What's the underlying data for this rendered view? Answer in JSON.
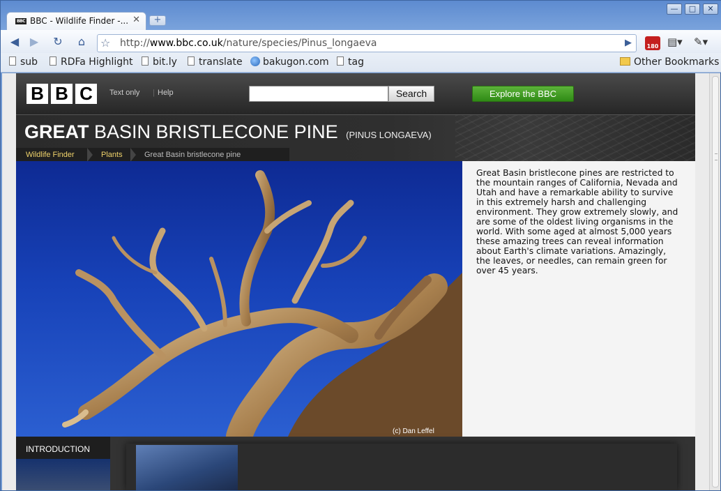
{
  "browser": {
    "tab_title": "BBC - Wildlife Finder -...",
    "tab_close": "✕",
    "new_tab": "+",
    "favicon_text": "BBC",
    "url_prefix": "http://",
    "url_domain": "www.bbc.co.uk",
    "url_path": "/nature/species/Pinus_longaeva",
    "extension_badge": "180",
    "window_controls": [
      "—",
      "□",
      "✕"
    ]
  },
  "bookmarks": [
    {
      "label": "sub",
      "icon": "page"
    },
    {
      "label": "RDFa Highlight",
      "icon": "page"
    },
    {
      "label": "bit.ly",
      "icon": "page"
    },
    {
      "label": "translate",
      "icon": "page"
    },
    {
      "label": "bakugon.com",
      "icon": "globe"
    },
    {
      "label": "tag",
      "icon": "page"
    }
  ],
  "other_bookmarks": "Other Bookmarks",
  "bbc": {
    "logo": [
      "B",
      "B",
      "C"
    ],
    "text_only": "Text only",
    "help": "Help",
    "search_button": "Search",
    "search_placeholder": "",
    "explore_button": "Explore the BBC"
  },
  "species": {
    "title_bold": "GREAT",
    "title_rest": " BASIN BRISTLECONE PINE",
    "latin_name": "(PINUS LONGAEVA)",
    "breadcrumbs": [
      "Wildlife Finder",
      "Plants",
      "Great Basin bristlecone pine"
    ],
    "photo_credit": "(c) Dan Leffel",
    "description": "Great Basin bristlecone pines are restricted to the mountain ranges of California, Nevada and Utah and have a remarkable ability to survive in this extremely harsh and challenging environment. They grow extremely slowly, and are some of the oldest living organisms in the world. With some aged at almost 5,000 years these amazing trees can reveal information about Earth's climate variations. Amazingly, the leaves, or needles, can remain green for over 45 years.",
    "intro_tab": "INTRODUCTION"
  },
  "colors": {
    "explore_green": "#3a9a1e",
    "breadcrumb_link": "#f0d36b",
    "sky_blue": "#1742b8"
  }
}
